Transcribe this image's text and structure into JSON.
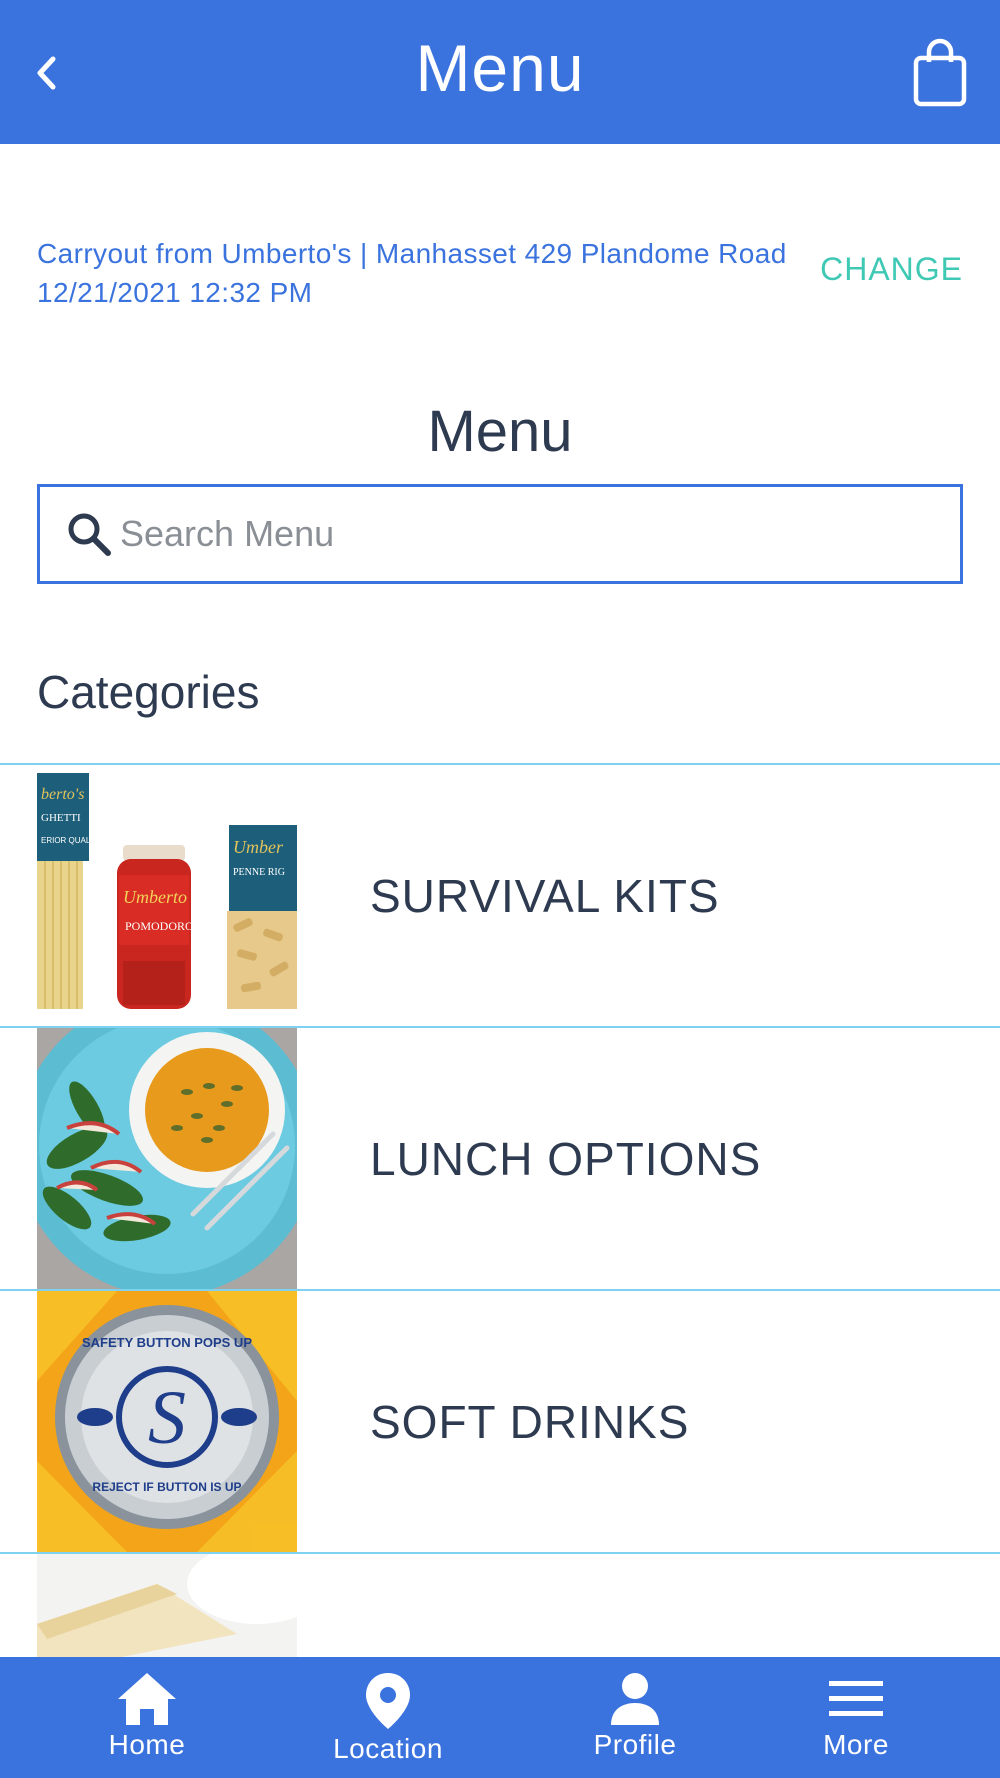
{
  "header": {
    "title": "Menu",
    "back_icon": "chevron-left-icon",
    "cart_icon": "shopping-bag-icon"
  },
  "order": {
    "info": "Carryout from Umberto's | Manhasset 429 Plandome Road 12/21/2021 12:32 PM",
    "change_label": "CHANGE"
  },
  "menu": {
    "heading": "Menu",
    "search_placeholder": "Search Menu",
    "search_value": ""
  },
  "categories": {
    "title": "Categories",
    "items": [
      {
        "label": "SURVIVAL KITS",
        "image": "pasta-sauce-products"
      },
      {
        "label": "LUNCH OPTIONS",
        "image": "soup-and-salad-plate"
      },
      {
        "label": "SOFT DRINKS",
        "image": "bottle-cap"
      },
      {
        "label": "",
        "image": "cheesecake-slice"
      }
    ]
  },
  "tabbar": {
    "items": [
      {
        "label": "Home",
        "icon": "home-icon"
      },
      {
        "label": "Location",
        "icon": "map-pin-icon"
      },
      {
        "label": "Profile",
        "icon": "person-icon"
      },
      {
        "label": "More",
        "icon": "hamburger-menu-icon"
      }
    ]
  },
  "colors": {
    "brand_blue": "#3b73de",
    "accent_teal": "#3fc9b4",
    "divider": "#7fd2ef",
    "text_dark": "#2d3a4f"
  }
}
